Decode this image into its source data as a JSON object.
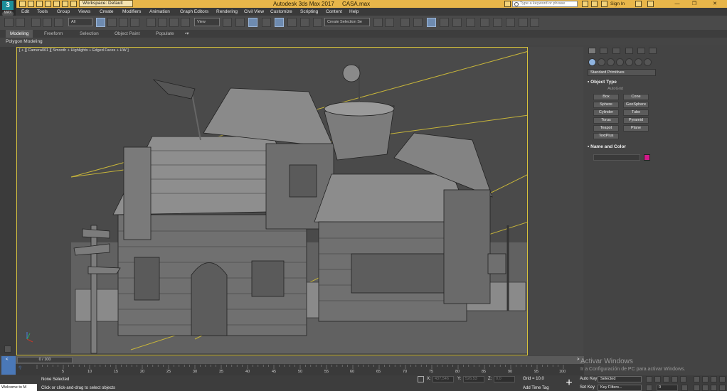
{
  "logo": {
    "mark": "3",
    "sub": "MAX"
  },
  "title": {
    "workspace": "Workspace: Default",
    "app": "Autodesk 3ds Max 2017",
    "file": "CASA.max",
    "search_placeholder": "Type a keyword or phrase",
    "sign_in": "Sign In"
  },
  "menu": [
    "Edit",
    "Tools",
    "Group",
    "Views",
    "Create",
    "Modifiers",
    "Animation",
    "Graph Editors",
    "Rendering",
    "Civil View",
    "Customize",
    "Scripting",
    "Content",
    "Help"
  ],
  "toolbar": {
    "filter": "All",
    "coord": "View",
    "selection_set": "Create Selection Se"
  },
  "ribbon": {
    "tabs": [
      "Modeling",
      "Freeform",
      "Selection",
      "Object Paint",
      "Populate"
    ],
    "active_tab": "Modeling",
    "panel_label": "Polygon Modeling"
  },
  "viewport": {
    "label": "[ + ][ Camera001 ][ Smooth + Highlights + Edged Faces + HW ]"
  },
  "command_panel": {
    "dropdown": "Standard Primitives",
    "object_type": {
      "header": "Object Type",
      "autogrid": "AutoGrid",
      "buttons": [
        "Box",
        "Cone",
        "Sphere",
        "GeoSphere",
        "Cylinder",
        "Tube",
        "Torus",
        "Pyramid",
        "Teapot",
        "Plane",
        "TextPlus"
      ]
    },
    "name_color": {
      "header": "Name and Color",
      "color": "#d21a8a"
    }
  },
  "timeline": {
    "frame_display": "0 / 100",
    "ticks": [
      "5",
      "10",
      "15",
      "20",
      "25",
      "30",
      "35",
      "40",
      "45",
      "50",
      "55",
      "60",
      "65",
      "70",
      "75",
      "80",
      "85",
      "90",
      "95",
      "100"
    ]
  },
  "status": {
    "welcome": "Welcome to M",
    "selection": "None Selected",
    "prompt": "Click or click-and-drag to select objects",
    "x_label": "X:",
    "x_value": "437,546",
    "y_label": "Y:",
    "y_value": "526,53",
    "z_label": "Z:",
    "z_value": "0,0",
    "grid": "Grid = 10,0",
    "add_time_tag": "Add Time Tag",
    "auto_key": "Auto Key",
    "set_key": "Set Key",
    "selected": "Selected",
    "key_filters": "Key Filters...",
    "frame": "0"
  },
  "watermark": {
    "line1": "Activar Windows",
    "line2": "Ir a Configuración de PC para activar Windows."
  }
}
